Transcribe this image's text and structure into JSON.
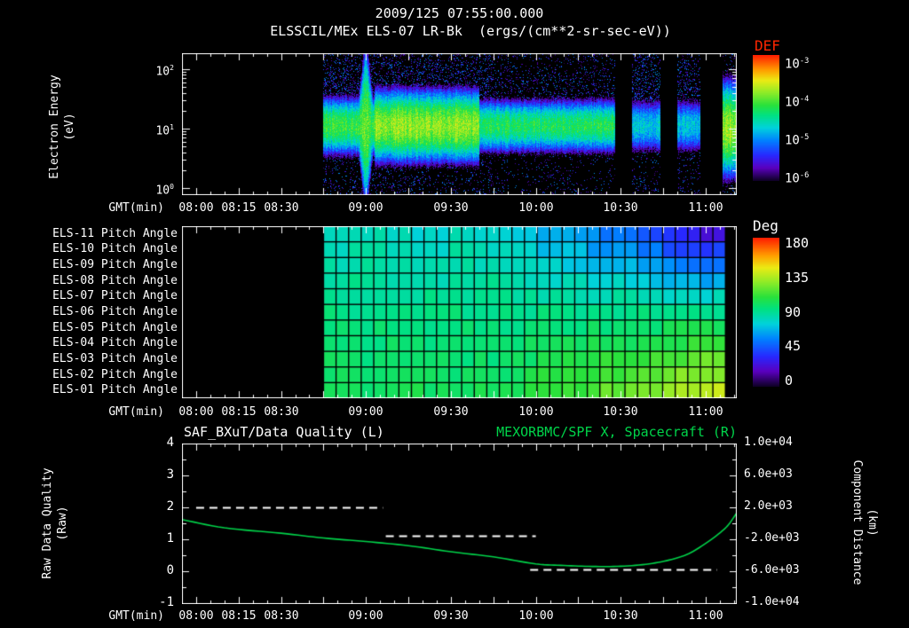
{
  "header": {
    "title": "2009/125 07:55:00.000",
    "subtitle": "ELSSCIL/MEx ELS-07 LR-Bk  (ergs/(cm**2-sr-sec-eV))"
  },
  "time_axis": {
    "label": "GMT(min)",
    "range_minutes": [
      475,
      671
    ],
    "ticks": [
      {
        "label": "08:00",
        "minute": 480
      },
      {
        "label": "08:15",
        "minute": 495
      },
      {
        "label": "08:30",
        "minute": 510
      },
      {
        "label": "09:00",
        "minute": 540
      },
      {
        "label": "09:30",
        "minute": 570
      },
      {
        "label": "10:00",
        "minute": 600
      },
      {
        "label": "10:30",
        "minute": 630
      },
      {
        "label": "11:00",
        "minute": 660
      }
    ]
  },
  "energy_panel": {
    "ylabel_line1": "Electron Energy",
    "ylabel_line2": "(eV)",
    "ytick_exponents": [
      2,
      1,
      0
    ],
    "colorbar": {
      "label": "DEF",
      "label_color": "#ff2600",
      "tick_exponents": [
        -3,
        -4,
        -5,
        -6
      ]
    }
  },
  "pitch_panel": {
    "row_labels": [
      "ELS-11 Pitch Angle",
      "ELS-10 Pitch Angle",
      "ELS-09 Pitch Angle",
      "ELS-08 Pitch Angle",
      "ELS-07 Pitch Angle",
      "ELS-06 Pitch Angle",
      "ELS-05 Pitch Angle",
      "ELS-04 Pitch Angle",
      "ELS-03 Pitch Angle",
      "ELS-02 Pitch Angle",
      "ELS-01 Pitch Angle"
    ],
    "colorbar": {
      "label": "Deg",
      "ticks": [
        180,
        135,
        90,
        45,
        0
      ]
    }
  },
  "bottom_panel": {
    "title_left": "SAF_BXuT/Data Quality (L)",
    "title_right": "MEXORBMC/SPF X, Spacecraft (R)",
    "left_axis": {
      "label_line1": "Raw Data Quality",
      "label_line2": "(Raw)",
      "ticks": [
        4,
        3,
        2,
        1,
        0,
        -1
      ]
    },
    "right_axis": {
      "label_line1": "Component Distance",
      "label_line2": "(km)",
      "ticks": [
        "1.0e+04",
        "6.0e+03",
        "2.0e+03",
        "-2.0e+03",
        "-6.0e+03",
        "-1.0e+04"
      ]
    }
  },
  "chart_data": [
    {
      "type": "heatmap",
      "name": "electron-energy-spectrogram",
      "title": "ELSSCIL/MEx ELS-07 LR-Bk",
      "units": "ergs/(cm**2-sr-sec-eV)",
      "xlabel": "GMT(min)",
      "ylabel": "Electron Energy (eV)",
      "yscale": "log",
      "ylim_eV": [
        1,
        200
      ],
      "color_scale": "log",
      "color_range_DEF": [
        1e-06,
        0.001
      ],
      "data_start_gmt": "08:45",
      "data_end_gmt": "11:11",
      "features": {
        "main_band": {
          "center_eV": 11,
          "width_decades": 0.28,
          "typical_peak_DEF": 4e-05
        },
        "bright_interval_gmt": [
          "09:03",
          "09:40"
        ],
        "spike_gmt": "09:00",
        "weak_intervals_gmt": [
          [
            "10:34",
            "10:44"
          ],
          [
            "10:50",
            "10:58"
          ]
        ],
        "gap_intervals_gmt": [
          [
            "10:28",
            "10:34"
          ],
          [
            "10:44",
            "10:50"
          ],
          [
            "10:58",
            "11:06"
          ]
        ],
        "final_bright_gmt": [
          "11:06",
          "11:11"
        ]
      }
    },
    {
      "type": "heatmap",
      "name": "pitch-angle-grid",
      "rows": [
        "ELS-11",
        "ELS-10",
        "ELS-09",
        "ELS-08",
        "ELS-07",
        "ELS-06",
        "ELS-05",
        "ELS-04",
        "ELS-03",
        "ELS-02",
        "ELS-01"
      ],
      "value_units": "Deg",
      "value_range": [
        0,
        180
      ],
      "columns": 32,
      "data_start_gmt": "08:45",
      "data_end_gmt": "11:07",
      "pattern": {
        "base_angle_deg": 93,
        "early_spread_per_row_deg": 2.5,
        "late_spread_per_row_deg": 14,
        "spread_ramp_start_fraction": 0.35,
        "lower_row_asymmetry": 0.62,
        "description": "Uniform ~90 deg (green) early; after ~10:00 upper anodes (ELS-08..11) trend toward 25-60 deg (blue) and lower anodes (ELS-01..03) toward 115-135 deg (yellow)."
      }
    },
    {
      "type": "line",
      "name": "quality-and-spacecraft-x",
      "title_left": "SAF_BXuT/Data Quality (L)",
      "title_right": "MEXORBMC/SPF X, Spacecraft (R)",
      "left_axis": {
        "label": "Raw Data Quality (Raw)",
        "range": [
          -1,
          4
        ]
      },
      "right_axis": {
        "label": "Component Distance (km)",
        "range": [
          -10000,
          10000
        ]
      },
      "series": [
        {
          "name": "SAF_BXuT/Data Quality",
          "axis": "left",
          "color": "#ffffff",
          "style": "dashed",
          "steps": [
            {
              "gmt": [
                "08:00",
                "09:06"
              ],
              "value": 2.0
            },
            {
              "gmt": [
                "09:07",
                "10:00"
              ],
              "value": 1.1
            },
            {
              "gmt": [
                "09:58",
                "11:04"
              ],
              "value": 0.05
            }
          ]
        },
        {
          "name": "MEXORBMC/SPF X, Spacecraft",
          "axis": "right",
          "color": "#00d44a",
          "style": "solid",
          "points_gmt_km": [
            [
              "07:55",
              480
            ],
            [
              "08:10",
              -560
            ],
            [
              "08:30",
              -1240
            ],
            [
              "08:45",
              -1840
            ],
            [
              "09:00",
              -2280
            ],
            [
              "09:15",
              -2800
            ],
            [
              "09:30",
              -3560
            ],
            [
              "09:45",
              -4200
            ],
            [
              "10:00",
              -5080
            ],
            [
              "10:10",
              -5280
            ],
            [
              "10:20",
              -5400
            ],
            [
              "10:30",
              -5380
            ],
            [
              "10:40",
              -5080
            ],
            [
              "10:48",
              -4520
            ],
            [
              "10:54",
              -3800
            ],
            [
              "11:00",
              -2520
            ],
            [
              "11:05",
              -1200
            ],
            [
              "11:08",
              -200
            ],
            [
              "11:11",
              1320
            ]
          ]
        }
      ]
    }
  ]
}
